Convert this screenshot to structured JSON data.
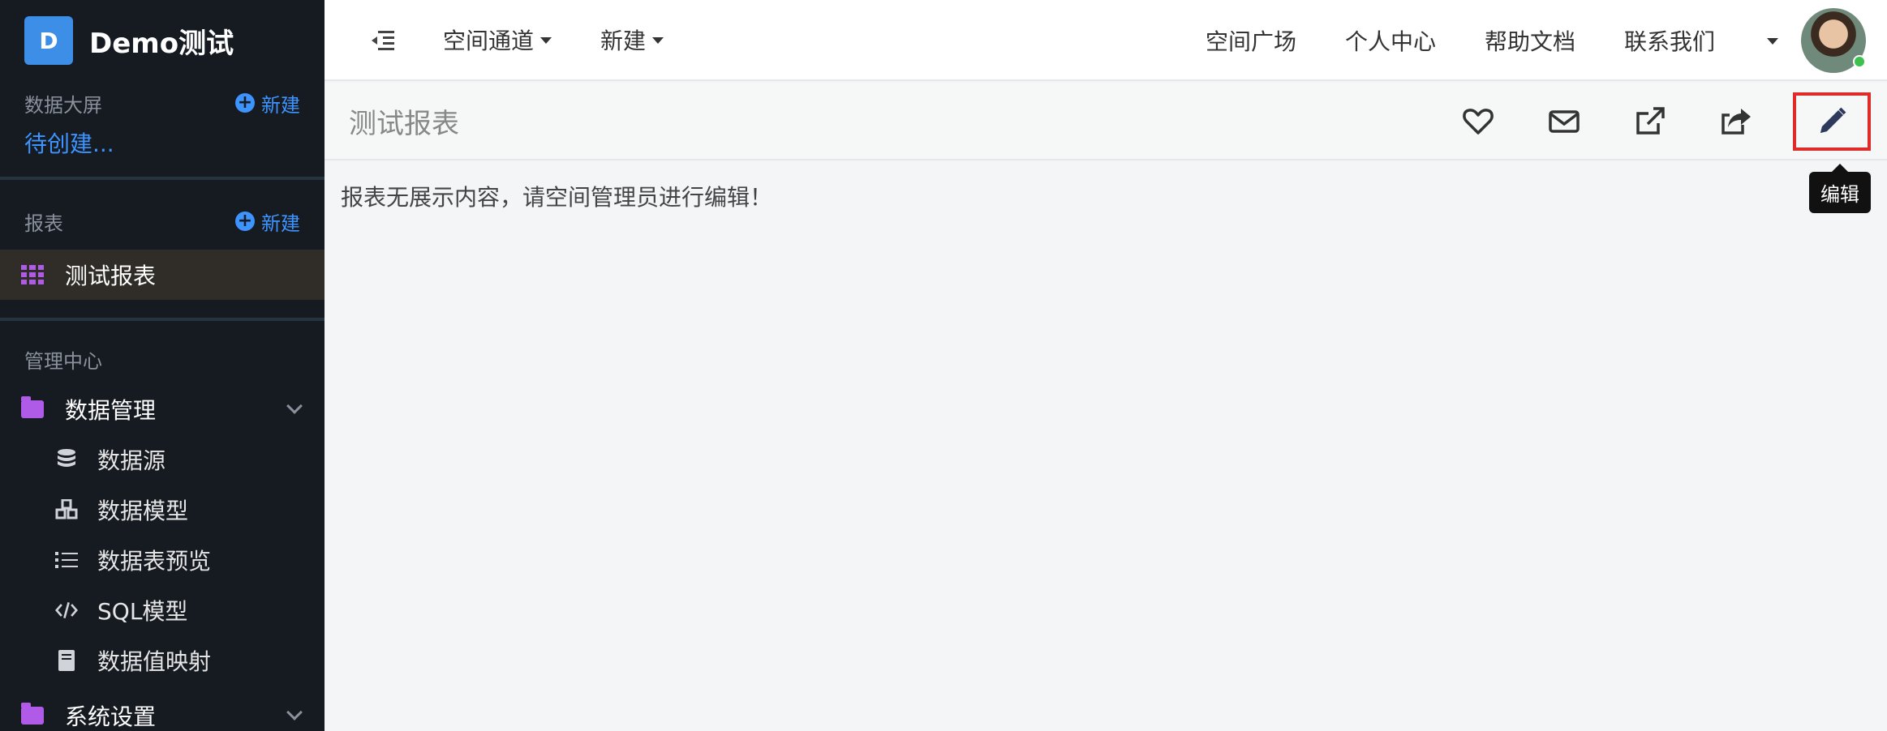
{
  "brand": {
    "logo_letter": "D",
    "name": "Demo测试"
  },
  "sidebar": {
    "dashboard": {
      "title": "数据大屏",
      "new_label": "新建",
      "pending": "待创建..."
    },
    "reports": {
      "title": "报表",
      "new_label": "新建",
      "active_item": "测试报表"
    },
    "admin": {
      "title": "管理中心",
      "data_mgmt": "数据管理",
      "sub_items": [
        "数据源",
        "数据模型",
        "数据表预览",
        "SQL模型",
        "数据值映射"
      ],
      "system_settings": "系统设置"
    }
  },
  "topbar": {
    "space_channel": "空间通道",
    "new_label": "新建",
    "links": [
      "空间广场",
      "个人中心",
      "帮助文档",
      "联系我们"
    ]
  },
  "page": {
    "title": "测试报表",
    "empty_message": "报表无展示内容，请空间管理员进行编辑！",
    "edit_tooltip": "编辑"
  },
  "icons": {
    "favorite": "heart-icon",
    "email": "mail-icon",
    "open": "external-link-icon",
    "share": "share-icon",
    "edit": "pencil-icon"
  },
  "colors": {
    "accent": "#3d94ff",
    "sidebar_bg": "#161b22",
    "highlight": "#e02b2b",
    "purple": "#b05be8"
  }
}
